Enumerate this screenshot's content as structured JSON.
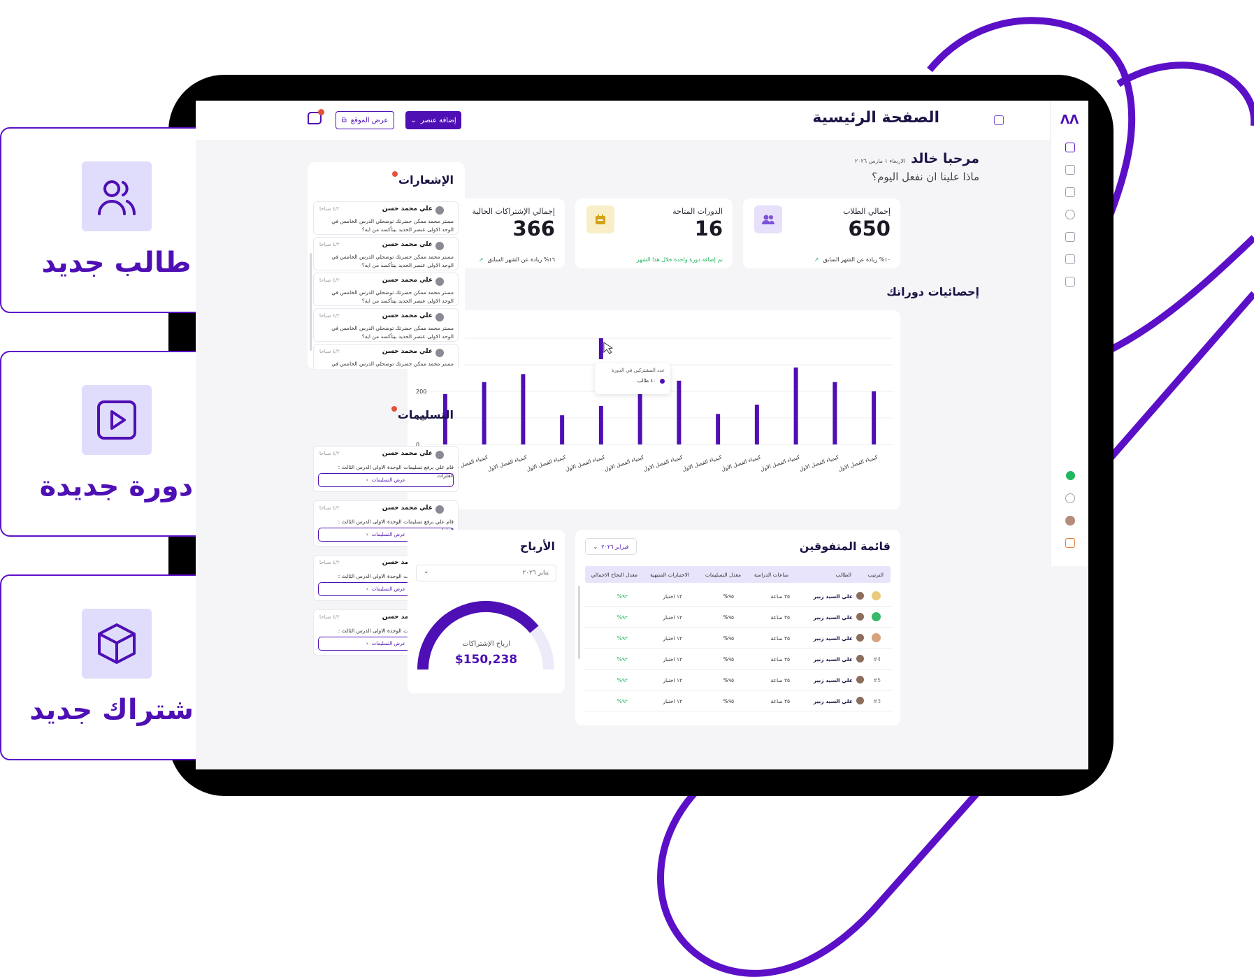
{
  "quick_actions": [
    {
      "label": "طالب جديد",
      "icon": "users-icon"
    },
    {
      "label": "دورة جديدة",
      "icon": "play-icon"
    },
    {
      "label": "اشتراك جديد",
      "icon": "box-icon"
    }
  ],
  "header": {
    "title": "الصفحة الرئيسية",
    "add_button": "إضافة عنصر",
    "site_button": "عرض الموقع"
  },
  "welcome": {
    "greeting": "مرحبا خالد",
    "date": "الاربعاء ١ مارس ٢٠٢٦",
    "question": "ماذا علينا ان نفعل اليوم؟"
  },
  "stats": [
    {
      "label": "إجمالي الطلاب",
      "value": "650",
      "foot": "١٠% زيادة عن الشهر السابق",
      "accent": "#7b52d8",
      "icon": "users-icon"
    },
    {
      "label": "الدورات المتاحة",
      "value": "16",
      "foot": "تم إضافة دورة واحدة خلال هذا الشهر",
      "accent": "#d4a118",
      "icon": "calendar-icon"
    },
    {
      "label": "إجمالي الإشتراكات الحالية",
      "value": "366",
      "foot": "١٦% زيادة عن الشهر السابق",
      "accent": "#22b65f",
      "icon": "money-icon"
    }
  ],
  "course_stats_title": "إحصائيات دوراتك",
  "chart_data": {
    "type": "bar",
    "categories": [
      "كيمياء الفصل الاول",
      "كيمياء الفصل الاول",
      "كيمياء الفصل الاول",
      "كيمياء الفصل الاول",
      "كيمياء الفصل الاول",
      "كيمياء الفصل الاول",
      "كيمياء الفصل الاول",
      "كيمياء الفصل الاول",
      "كيمياء الفصل الاول",
      "كيمياء الفصل الاول",
      "كيمياء الفصل الاول",
      "كيمياء الفصل الاول"
    ],
    "values": [
      190,
      235,
      265,
      110,
      145,
      245,
      240,
      115,
      150,
      290,
      235,
      200
    ],
    "ylim": [
      0,
      400
    ],
    "yticks": [
      "0",
      "100",
      "200",
      "300",
      "400"
    ],
    "ytop": "100",
    "extra_bar": 400,
    "tooltip": {
      "title": "عدد المشتركين في الدورة",
      "value": "٤٠ طالب"
    },
    "bar_color": "#4e0fb4"
  },
  "notifications": {
    "title": "الإشعارات",
    "items": [
      {
        "name": "علي محمد حسن",
        "time": "٤/٢ صباحا",
        "text": "مستر محمد ممكن حضرتك توضحلي الدرس الخامس في الوحد الاولى عنصر الحديد بيتأكسد من ايه؟"
      },
      {
        "name": "علي محمد حسن",
        "time": "٤/٢ صباحا",
        "text": "مستر محمد ممكن حضرتك توضحلي الدرس الخامس في الوحد الاولى عنصر الحديد بيتأكسد من ايه؟"
      },
      {
        "name": "علي محمد حسن",
        "time": "٤/٢ صباحا",
        "text": "مستر محمد ممكن حضرتك توضحلي الدرس الخامس في الوحد الاولى عنصر الحديد بيتأكسد من ايه؟"
      },
      {
        "name": "علي محمد حسن",
        "time": "٤/٢ صباحا",
        "text": "مستر محمد ممكن حضرتك توضحلي الدرس الخامس في الوحد الاولى عنصر الحديد بيتأكسد من ايه؟"
      },
      {
        "name": "علي محمد حسن",
        "time": "٤/٢ صباحا",
        "text": "مستر محمد ممكن حضرتك توضحلي الدرس الخامس في الوحد"
      }
    ]
  },
  "deliveries": {
    "title": "التسليمات",
    "items": [
      {
        "name": "علي محمد حسن",
        "time": "٤/٢ صباحا",
        "text": "قام علي برفع تسليمات الوحدة الاولى الدرس الثالث : الفلزات",
        "button": "عرض التسليمات"
      },
      {
        "name": "علي محمد حسن",
        "time": "٤/٢ صباحا",
        "text": "قام علي برفع تسليمات الوحدة الاولى الدرس الثالث : الفلزات",
        "button": "عرض التسليمات"
      },
      {
        "name": "علي محمد حسن",
        "time": "٤/٢ صباحا",
        "text": "قام علي برفع تسليمات الوحدة الاولى الدرس الثالث : الفلزات",
        "button": "عرض التسليمات"
      },
      {
        "name": "علي محمد حسن",
        "time": "٤/٢ صباحا",
        "text": "قام علي برفع تسليمات الوحدة الاولى الدرس الثالث : الفلزات",
        "button": "عرض التسليمات"
      }
    ]
  },
  "leaderboard": {
    "title": "قائمة المتفوقين",
    "month": "فبراير ٢٠٢٦",
    "headers": [
      "الترتيب",
      "الطالب",
      "ساعات الدراسة",
      "معدل التسليمات",
      "الاختبارات المنتهية",
      "معدل النجاح الاجمالي"
    ],
    "rows": [
      {
        "rank": "",
        "name": "علي السيد زبير",
        "hours": "٢٥ ساعة",
        "rate": "٩٥%",
        "tests": "١٢ اختبار",
        "success": "٩٢%"
      },
      {
        "rank": "",
        "name": "علي السيد زبير",
        "hours": "٢٥ ساعة",
        "rate": "٩٥%",
        "tests": "١٢ اختبار",
        "success": "٩٢%"
      },
      {
        "rank": "",
        "name": "علي السيد زبير",
        "hours": "٢٥ ساعة",
        "rate": "٩٥%",
        "tests": "١٢ اختبار",
        "success": "٩٢%"
      },
      {
        "rank": "#4",
        "name": "علي السيد زبير",
        "hours": "٢٥ ساعة",
        "rate": "٩٥%",
        "tests": "١٢ اختبار",
        "success": "٩٢%"
      },
      {
        "rank": "#5",
        "name": "علي السيد زبير",
        "hours": "٢٥ ساعة",
        "rate": "٩٥%",
        "tests": "١٢ اختبار",
        "success": "٩٢%"
      },
      {
        "rank": "#3",
        "name": "علي السيد زبير",
        "hours": "٢٥ ساعة",
        "rate": "٩٥%",
        "tests": "١٢ اختبار",
        "success": "٩٢%"
      }
    ]
  },
  "earnings": {
    "title": "الأرباح",
    "month": "يناير ٢٠٢٦",
    "caption": "ارباح الإشتراكات",
    "amount": "$150,238",
    "progress": 0.78
  }
}
